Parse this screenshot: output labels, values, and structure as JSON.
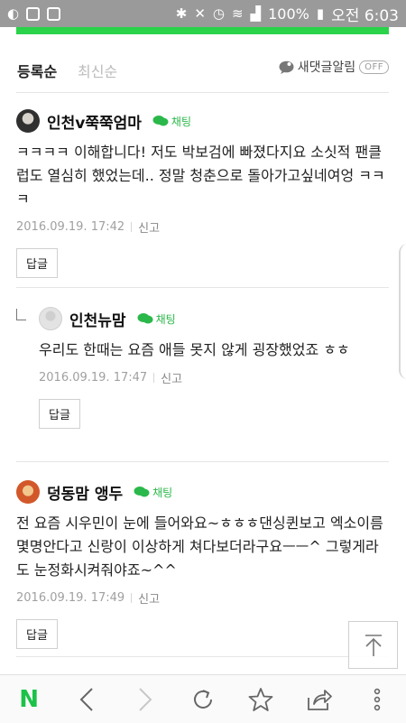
{
  "status_bar": {
    "battery": "100%",
    "time": "오전 6:03"
  },
  "sort": {
    "active": "등록순",
    "inactive": "최신순",
    "alarm_label": "새댓글알림",
    "alarm_toggle": "OFF"
  },
  "chat_label": "채팅",
  "reply_button_label": "답글",
  "report_label": "신고",
  "comments": [
    {
      "name": "인천v쭉쭉엄마",
      "text": "ㅋㅋㅋㅋ 이해합니다! 저도 박보검에 빠졌다지요 소싯적 팬클럽도 열심히 했었는데.. 정말 청춘으로 돌아가고싶네여엉 ㅋㅋㅋ",
      "date": "2016.09.19. 17:42"
    },
    {
      "name": "인천뉴맘",
      "text": "우리도 한때는 요즘 애들 못지 않게 굉장했었죠 ㅎㅎ",
      "date": "2016.09.19. 17:47"
    },
    {
      "name": "덩동맘 앵두",
      "text": "전 요즘 시우민이 눈에 들어와요~ㅎㅎㅎ댄싱퀸보고 엑소이름몇명안다고 신랑이 이상하게 쳐다보더라구요ㅡㅡ^ 그렇게라도 눈정화시켜줘야죠~^^",
      "date": "2016.09.19. 17:49"
    }
  ],
  "icons": {
    "bottom_bar": [
      "naver-n-icon",
      "back-icon",
      "forward-icon",
      "refresh-icon",
      "star-icon",
      "share-icon",
      "more-icon"
    ]
  },
  "colors": {
    "brand_green": "#1bc248",
    "chat_green": "#2bb84a",
    "status_bar": "#9a9a9a"
  }
}
